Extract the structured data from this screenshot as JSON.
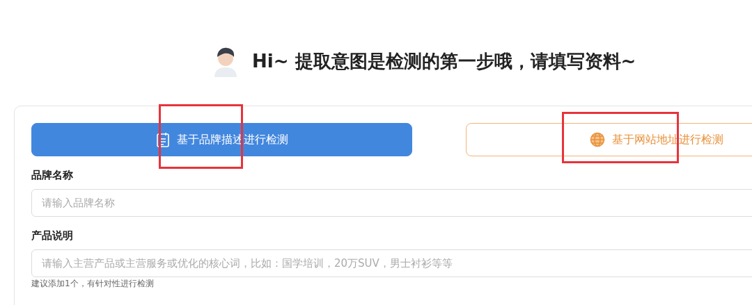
{
  "header": {
    "title": "Hi~ 提取意图是检测的第一步哦，请填写资料~"
  },
  "tabs": [
    {
      "label": "基于品牌描述进行检测",
      "selected": true,
      "highlighted": true
    },
    {
      "label": "基于网站地址进行检测",
      "selected": false,
      "highlighted": true
    }
  ],
  "fields": [
    {
      "label": "品牌名称",
      "placeholder": "请输入品牌名称"
    },
    {
      "label": "产品说明",
      "placeholder": "请输入主营产品或主营服务或优化的核心词，比如：国学培训，20万SUV，男士衬衫等等",
      "hint": "建议添加1个，有针对性进行检测"
    }
  ]
}
